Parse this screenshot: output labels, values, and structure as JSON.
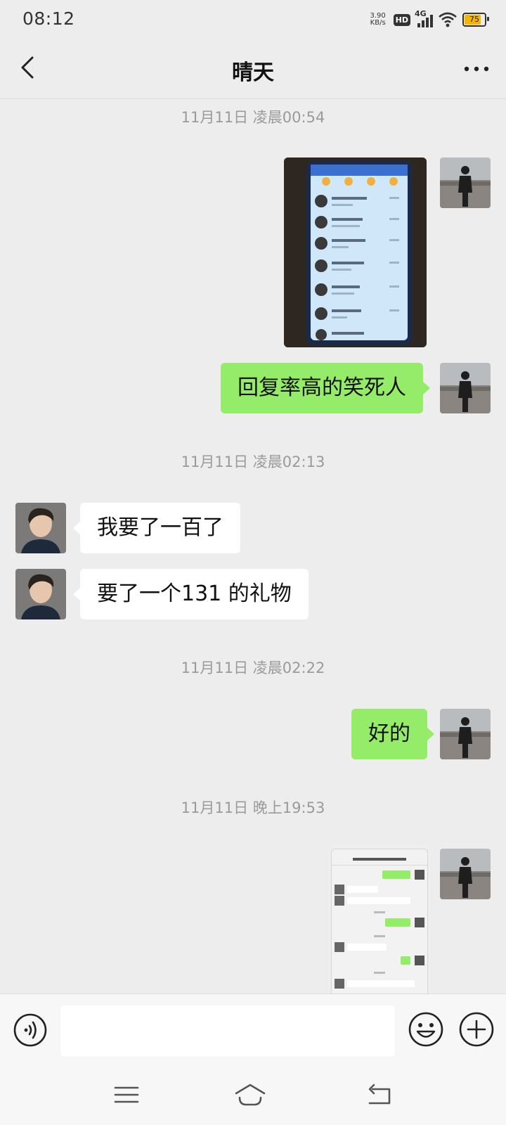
{
  "status_bar": {
    "time": "08:12",
    "net_speed_value": "3.90",
    "net_speed_unit": "KB/s",
    "hd": "HD",
    "network": "4G",
    "battery": "75"
  },
  "header": {
    "title": "晴天"
  },
  "messages": {
    "ts1": "11月11日 凌晨00:54",
    "m2": "回复率高的笑死人",
    "ts2": "11月11日 凌晨02:13",
    "m3": "我要了一百了",
    "m4": "要了一个131 的礼物",
    "ts3": "11月11日 凌晨02:22",
    "m5": "好的",
    "ts4": "11月11日 晚上19:53"
  },
  "input_bar": {
    "value": ""
  },
  "colors": {
    "my_bubble": "#95ec69",
    "their_bubble": "#ffffff",
    "background": "#ededed"
  }
}
